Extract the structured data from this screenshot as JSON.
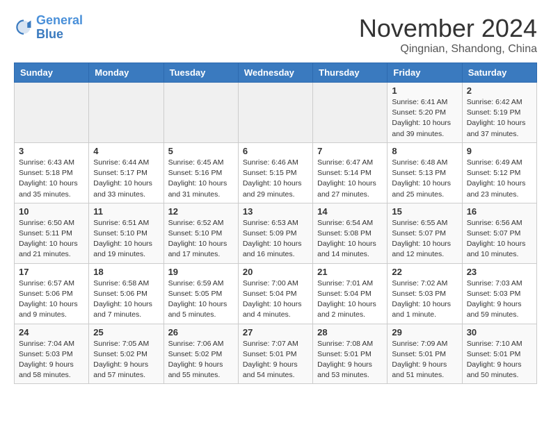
{
  "logo": {
    "line1": "General",
    "line2": "Blue"
  },
  "title": "November 2024",
  "subtitle": "Qingnian, Shandong, China",
  "days_of_week": [
    "Sunday",
    "Monday",
    "Tuesday",
    "Wednesday",
    "Thursday",
    "Friday",
    "Saturday"
  ],
  "weeks": [
    [
      {
        "day": "",
        "info": ""
      },
      {
        "day": "",
        "info": ""
      },
      {
        "day": "",
        "info": ""
      },
      {
        "day": "",
        "info": ""
      },
      {
        "day": "",
        "info": ""
      },
      {
        "day": "1",
        "info": "Sunrise: 6:41 AM\nSunset: 5:20 PM\nDaylight: 10 hours and 39 minutes."
      },
      {
        "day": "2",
        "info": "Sunrise: 6:42 AM\nSunset: 5:19 PM\nDaylight: 10 hours and 37 minutes."
      }
    ],
    [
      {
        "day": "3",
        "info": "Sunrise: 6:43 AM\nSunset: 5:18 PM\nDaylight: 10 hours and 35 minutes."
      },
      {
        "day": "4",
        "info": "Sunrise: 6:44 AM\nSunset: 5:17 PM\nDaylight: 10 hours and 33 minutes."
      },
      {
        "day": "5",
        "info": "Sunrise: 6:45 AM\nSunset: 5:16 PM\nDaylight: 10 hours and 31 minutes."
      },
      {
        "day": "6",
        "info": "Sunrise: 6:46 AM\nSunset: 5:15 PM\nDaylight: 10 hours and 29 minutes."
      },
      {
        "day": "7",
        "info": "Sunrise: 6:47 AM\nSunset: 5:14 PM\nDaylight: 10 hours and 27 minutes."
      },
      {
        "day": "8",
        "info": "Sunrise: 6:48 AM\nSunset: 5:13 PM\nDaylight: 10 hours and 25 minutes."
      },
      {
        "day": "9",
        "info": "Sunrise: 6:49 AM\nSunset: 5:12 PM\nDaylight: 10 hours and 23 minutes."
      }
    ],
    [
      {
        "day": "10",
        "info": "Sunrise: 6:50 AM\nSunset: 5:11 PM\nDaylight: 10 hours and 21 minutes."
      },
      {
        "day": "11",
        "info": "Sunrise: 6:51 AM\nSunset: 5:10 PM\nDaylight: 10 hours and 19 minutes."
      },
      {
        "day": "12",
        "info": "Sunrise: 6:52 AM\nSunset: 5:10 PM\nDaylight: 10 hours and 17 minutes."
      },
      {
        "day": "13",
        "info": "Sunrise: 6:53 AM\nSunset: 5:09 PM\nDaylight: 10 hours and 16 minutes."
      },
      {
        "day": "14",
        "info": "Sunrise: 6:54 AM\nSunset: 5:08 PM\nDaylight: 10 hours and 14 minutes."
      },
      {
        "day": "15",
        "info": "Sunrise: 6:55 AM\nSunset: 5:07 PM\nDaylight: 10 hours and 12 minutes."
      },
      {
        "day": "16",
        "info": "Sunrise: 6:56 AM\nSunset: 5:07 PM\nDaylight: 10 hours and 10 minutes."
      }
    ],
    [
      {
        "day": "17",
        "info": "Sunrise: 6:57 AM\nSunset: 5:06 PM\nDaylight: 10 hours and 9 minutes."
      },
      {
        "day": "18",
        "info": "Sunrise: 6:58 AM\nSunset: 5:06 PM\nDaylight: 10 hours and 7 minutes."
      },
      {
        "day": "19",
        "info": "Sunrise: 6:59 AM\nSunset: 5:05 PM\nDaylight: 10 hours and 5 minutes."
      },
      {
        "day": "20",
        "info": "Sunrise: 7:00 AM\nSunset: 5:04 PM\nDaylight: 10 hours and 4 minutes."
      },
      {
        "day": "21",
        "info": "Sunrise: 7:01 AM\nSunset: 5:04 PM\nDaylight: 10 hours and 2 minutes."
      },
      {
        "day": "22",
        "info": "Sunrise: 7:02 AM\nSunset: 5:03 PM\nDaylight: 10 hours and 1 minute."
      },
      {
        "day": "23",
        "info": "Sunrise: 7:03 AM\nSunset: 5:03 PM\nDaylight: 9 hours and 59 minutes."
      }
    ],
    [
      {
        "day": "24",
        "info": "Sunrise: 7:04 AM\nSunset: 5:03 PM\nDaylight: 9 hours and 58 minutes."
      },
      {
        "day": "25",
        "info": "Sunrise: 7:05 AM\nSunset: 5:02 PM\nDaylight: 9 hours and 57 minutes."
      },
      {
        "day": "26",
        "info": "Sunrise: 7:06 AM\nSunset: 5:02 PM\nDaylight: 9 hours and 55 minutes."
      },
      {
        "day": "27",
        "info": "Sunrise: 7:07 AM\nSunset: 5:01 PM\nDaylight: 9 hours and 54 minutes."
      },
      {
        "day": "28",
        "info": "Sunrise: 7:08 AM\nSunset: 5:01 PM\nDaylight: 9 hours and 53 minutes."
      },
      {
        "day": "29",
        "info": "Sunrise: 7:09 AM\nSunset: 5:01 PM\nDaylight: 9 hours and 51 minutes."
      },
      {
        "day": "30",
        "info": "Sunrise: 7:10 AM\nSunset: 5:01 PM\nDaylight: 9 hours and 50 minutes."
      }
    ]
  ]
}
